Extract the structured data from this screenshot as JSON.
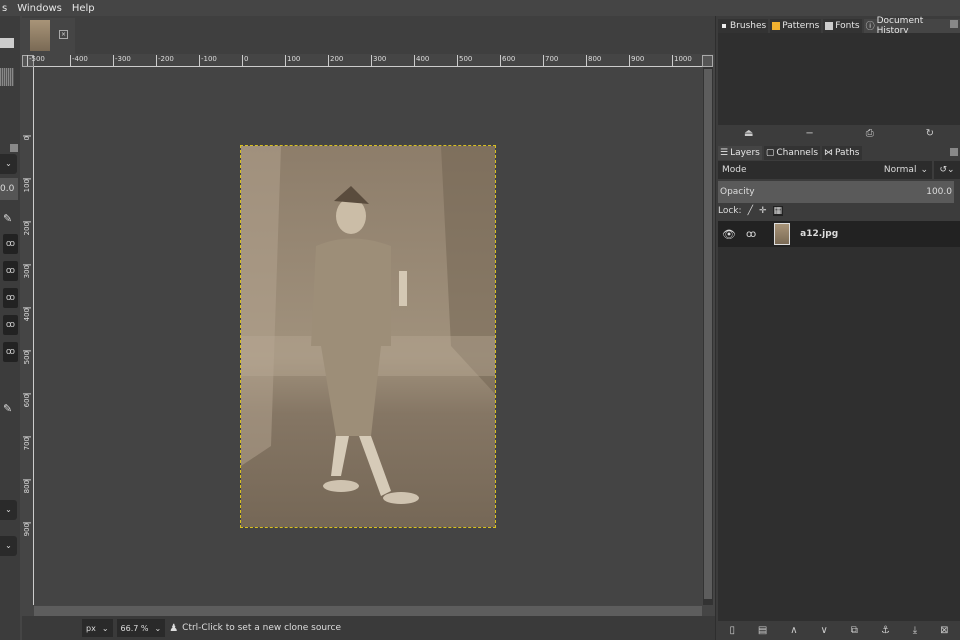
{
  "menubar": {
    "items": [
      "s",
      "Windows",
      "Help"
    ]
  },
  "image_tab": {
    "close_icon": "close-icon"
  },
  "ruler_h": [
    "-500",
    "-400",
    "-300",
    "-200",
    "-100",
    "0",
    "100",
    "200",
    "300",
    "400",
    "500",
    "600",
    "700",
    "800",
    "900",
    "1000"
  ],
  "ruler_v": [
    "0",
    "100",
    "200",
    "300",
    "400",
    "500",
    "600",
    "700",
    "800",
    "900"
  ],
  "toolbox": {
    "value_field": "0.0"
  },
  "dock_top": {
    "tabs": [
      "Brushes",
      "Patterns",
      "Fonts",
      "Document History"
    ]
  },
  "layers_panel": {
    "tabs": [
      "Layers",
      "Channels",
      "Paths"
    ],
    "mode_label": "Mode",
    "mode_value": "Normal",
    "opacity_label": "Opacity",
    "opacity_value": "100.0",
    "lock_label": "Lock:",
    "layers": [
      {
        "name": "a12.jpg",
        "visible": true
      }
    ]
  },
  "statusbar": {
    "unit": "px",
    "zoom": "66.7 %",
    "message": "Ctrl-Click to set a new clone source"
  }
}
